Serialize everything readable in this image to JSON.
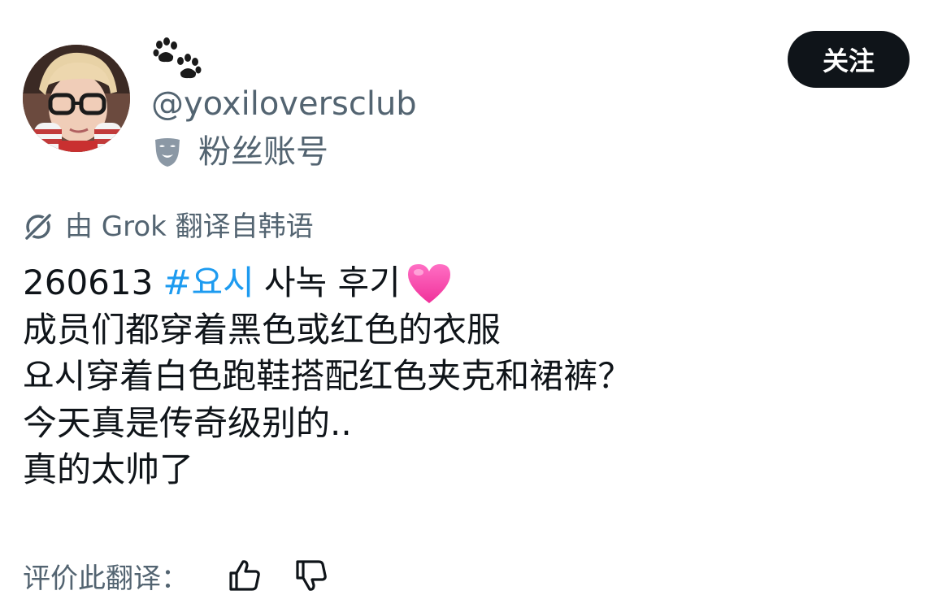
{
  "user": {
    "name_emoji": "🐾",
    "handle": "@yoxiloversclub",
    "label": "粉丝账号",
    "label_icon": "theater-mask-icon",
    "avatar": "avatar-photo"
  },
  "actions": {
    "follow_label": "关注"
  },
  "translation": {
    "notice": "由 Grok 翻译自韩语",
    "notice_icon": "grok-icon",
    "rate_label": "评价此翻译：",
    "thumb_up_icon": "thumbs-up-icon",
    "thumb_down_icon": "thumbs-down-icon"
  },
  "tweet": {
    "line1_prefix": "260613",
    "hashtag": "#요시",
    "line1_suffix": "사녹 후기",
    "line1_emoji": "heart-emoji",
    "line2": "成员们都穿着黑色或红色的衣服",
    "line3": "요시穿着白色跑鞋搭配红色夹克和裙裤？",
    "line4": "今天真是传奇级别的..",
    "line5": "真的太帅了"
  },
  "colors": {
    "link": "#1d9bf0",
    "text_primary": "#0f1419",
    "text_secondary": "#536471",
    "button_bg": "#0f1419"
  }
}
